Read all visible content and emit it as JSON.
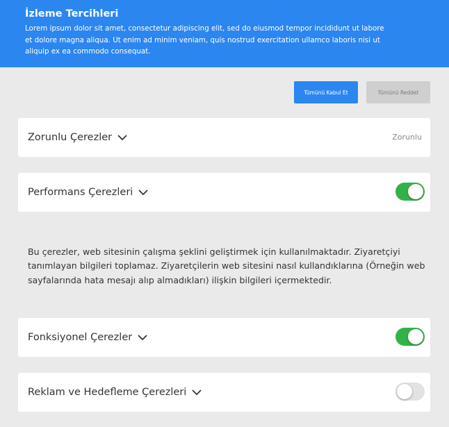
{
  "header": {
    "title": "İzleme Tercihleri",
    "description": "Lorem ipsum dolor sit amet, consectetur adipiscing elit, sed do eiusmod tempor incididunt ut labore et dolore magna aliqua. Ut enim ad minim veniam, quis nostrud exercitation ullamco laboris nisi ut aliquip ex ea commodo consequat."
  },
  "buttons": {
    "accept_all": "Tümünü Kabul Et",
    "reject_all": "Tümünü Reddet"
  },
  "categories": [
    {
      "title": "Zorunlu Çerezler",
      "status_text": "Zorunlu",
      "icon": "chevron-down-icon"
    },
    {
      "title": "Performans Çerezleri",
      "toggle": "on",
      "icon": "chevron-down-icon",
      "description": "Bu çerezler, web sitesinin çalışma şeklini geliştirmek için kullanılmaktadır. Ziyaretçiyi tanımlayan bilgileri toplamaz. Ziyaretçilerin web sitesini nasıl kullandıklarına (Örneğin web sayfalarında hata mesajı alıp almadıkları) ilişkin bilgileri içermektedir."
    },
    {
      "title": "Fonksiyonel Çerezler",
      "toggle": "on",
      "icon": "chevron-down-icon"
    },
    {
      "title": "Reklam ve Hedefleme Çerezleri",
      "toggle": "off",
      "icon": "chevron-down-icon"
    }
  ],
  "colors": {
    "accent": "#2b86f0",
    "toggle_on": "#34b24a",
    "toggle_off": "#e2e2e2",
    "background": "#eaeaea"
  }
}
